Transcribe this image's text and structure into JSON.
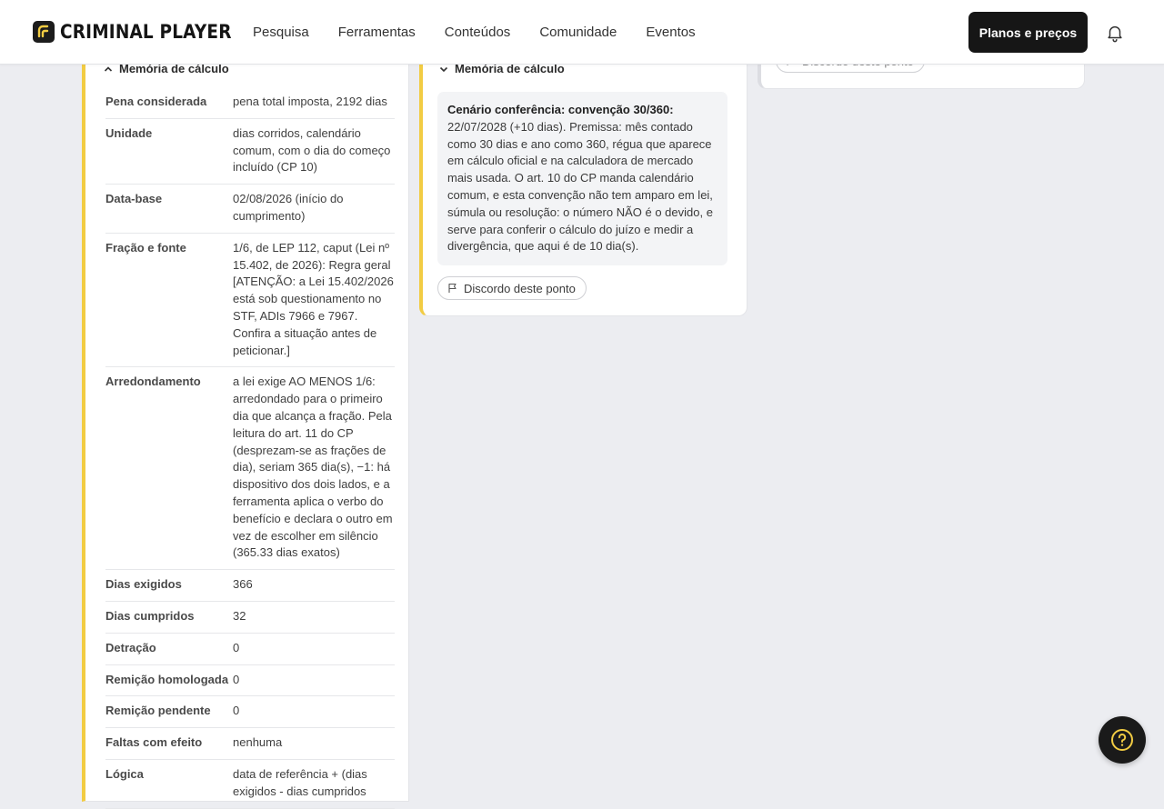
{
  "brand": {
    "name": "CRIMINAL PLAYER",
    "logo_icon": "cp-logo-icon"
  },
  "nav": {
    "items": [
      "Pesquisa",
      "Ferramentas",
      "Conteúdos",
      "Comunidade",
      "Eventos"
    ]
  },
  "header": {
    "cta_label": "Planos e preços",
    "bell_icon": "bell-icon"
  },
  "left_panel": {
    "section_title": "Memória de cálculo",
    "rows": [
      {
        "key": "Pena considerada",
        "value": "pena total imposta, 2192 dias"
      },
      {
        "key": "Unidade",
        "value": "dias corridos, calendário comum, com o dia do começo incluído (CP 10)"
      },
      {
        "key": "Data-base",
        "value": "02/08/2026 (início do cumprimento)"
      },
      {
        "key": "Fração e fonte",
        "value": "1/6, de LEP 112, caput (Lei nº 15.402, de 2026): Regra geral [ATENÇÃO: a Lei 15.402/2026 está sob questionamento no STF, ADIs 7966 e 7967. Confira a situação antes de peticionar.]"
      },
      {
        "key": "Arredondamento",
        "value": "a lei exige AO MENOS 1/6: arredondado para o primeiro dia que alcança a fração. Pela leitura do art. 11 do CP (desprezam-se as frações de dia), seriam 365 dia(s), −1: há dispositivo dos dois lados, e a ferramenta aplica o verbo do benefício e declara o outro em vez de escolher em silêncio (365.33 dias exatos)"
      },
      {
        "key": "Dias exigidos",
        "value": "366"
      },
      {
        "key": "Dias cumpridos",
        "value": "32"
      },
      {
        "key": "Detração",
        "value": "0"
      },
      {
        "key": "Remição homologada",
        "value": "0"
      },
      {
        "key": "Remição pendente",
        "value": "0"
      },
      {
        "key": "Faltas com efeito",
        "value": "nenhuma"
      },
      {
        "key": "Lógica",
        "value": "data de referência + (dias exigidos - dias cumpridos"
      }
    ]
  },
  "middle_panel": {
    "section_title": "Memória de cálculo",
    "scenario_title": "Cenário conferência: convenção 30/360:",
    "scenario_text": "22/07/2028 (+10 dias). Premissa: mês contado como 30 dias e ano como 360, régua que aparece em cálculo oficial e na calculadora de mercado mais usada. O art. 10 do CP manda calendário comum, e esta convenção não tem amparo em lei, súmula ou resolução: o número NÃO é o devido, e serve para conferir o cálculo do juízo e medir a divergência, que aqui é de 10 dia(s).",
    "dispute_label": "Discordo deste ponto"
  },
  "right_panel": {
    "dispute_label": "Discordo deste ponto"
  },
  "help": {
    "icon": "question-circle-icon"
  },
  "colors": {
    "accent": "#f2cc43",
    "dark": "#161616"
  }
}
